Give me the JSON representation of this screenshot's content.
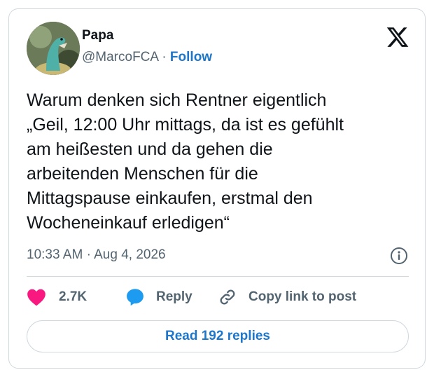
{
  "author": {
    "display_name": "Papa",
    "handle": "@MarcoFCA",
    "separator": "·",
    "follow_label": "Follow"
  },
  "tweet": {
    "lines": [
      "Warum denken sich Rentner eigentlich",
      "„Geil, 12:00 Uhr mittags, da ist es gefühlt",
      "am heißesten und da gehen die",
      "arbeitenden Menschen für die",
      "Mittagspause einkaufen, erstmal den",
      "Wocheneinkauf erledigen“"
    ],
    "time": "10:33 AM",
    "separator": "·",
    "date": "Aug 4, 2026"
  },
  "actions": {
    "like_count": "2.7K",
    "reply_label": "Reply",
    "copy_link_label": "Copy link to post"
  },
  "read_replies_label": "Read 192 replies",
  "icons": {
    "platform": "x-logo-icon",
    "info": "info-icon",
    "like": "heart-icon",
    "reply": "speech-bubble-icon",
    "copy": "link-icon"
  },
  "colors": {
    "link_blue": "#1d76c9",
    "heart_pink": "#f91880",
    "reply_blue": "#1d9bf0",
    "secondary_text": "#536471",
    "border": "#cfd9de"
  }
}
